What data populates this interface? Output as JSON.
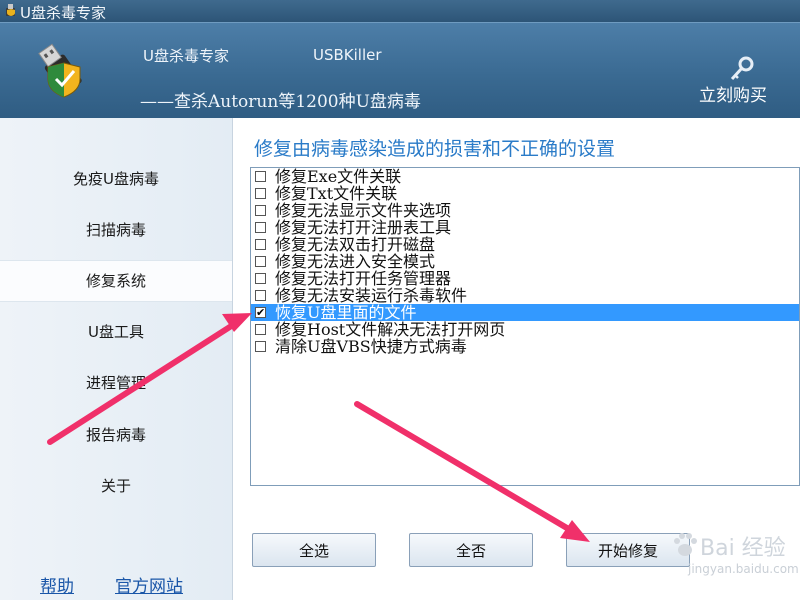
{
  "window": {
    "title": "U盘杀毒专家"
  },
  "header": {
    "product_name": "U盘杀毒专家",
    "product_en": "USBKiller",
    "slogan": "——查杀Autorun等1200种U盘病毒",
    "buy_label": "立刻购买"
  },
  "sidebar": {
    "items": [
      {
        "label": "免疫U盘病毒",
        "active": false
      },
      {
        "label": "扫描病毒",
        "active": false
      },
      {
        "label": "修复系统",
        "active": true
      },
      {
        "label": "U盘工具",
        "active": false
      },
      {
        "label": "进程管理",
        "active": false
      },
      {
        "label": "报告病毒",
        "active": false
      },
      {
        "label": "关于",
        "active": false
      }
    ],
    "help_label": "帮助",
    "website_label": "官方网站"
  },
  "main": {
    "heading": "修复由病毒感染造成的损害和不正确的设置",
    "repairs": [
      {
        "label": "修复Exe文件关联",
        "checked": false,
        "selected": false
      },
      {
        "label": "修复Txt文件关联",
        "checked": false,
        "selected": false
      },
      {
        "label": "修复无法显示文件夹选项",
        "checked": false,
        "selected": false
      },
      {
        "label": "修复无法打开注册表工具",
        "checked": false,
        "selected": false
      },
      {
        "label": "修复无法双击打开磁盘",
        "checked": false,
        "selected": false
      },
      {
        "label": "修复无法进入安全模式",
        "checked": false,
        "selected": false
      },
      {
        "label": "修复无法打开任务管理器",
        "checked": false,
        "selected": false
      },
      {
        "label": "修复无法安装运行杀毒软件",
        "checked": false,
        "selected": false
      },
      {
        "label": "恢复U盘里面的文件",
        "checked": true,
        "selected": true
      },
      {
        "label": "修复Host文件解决无法打开网页",
        "checked": false,
        "selected": false
      },
      {
        "label": "清除U盘VBS快捷方式病毒",
        "checked": false,
        "selected": false
      }
    ],
    "select_all_label": "全选",
    "select_none_label": "全否",
    "start_repair_label": "开始修复"
  },
  "watermark": {
    "text": "Bai 经验",
    "url": "jingyan.baidu.com"
  },
  "colors": {
    "header_bg": "#3a6a92",
    "heading": "#2a7bc8",
    "selection": "#3399ff",
    "arrow": "#f0306a",
    "link": "#1a56a8"
  }
}
